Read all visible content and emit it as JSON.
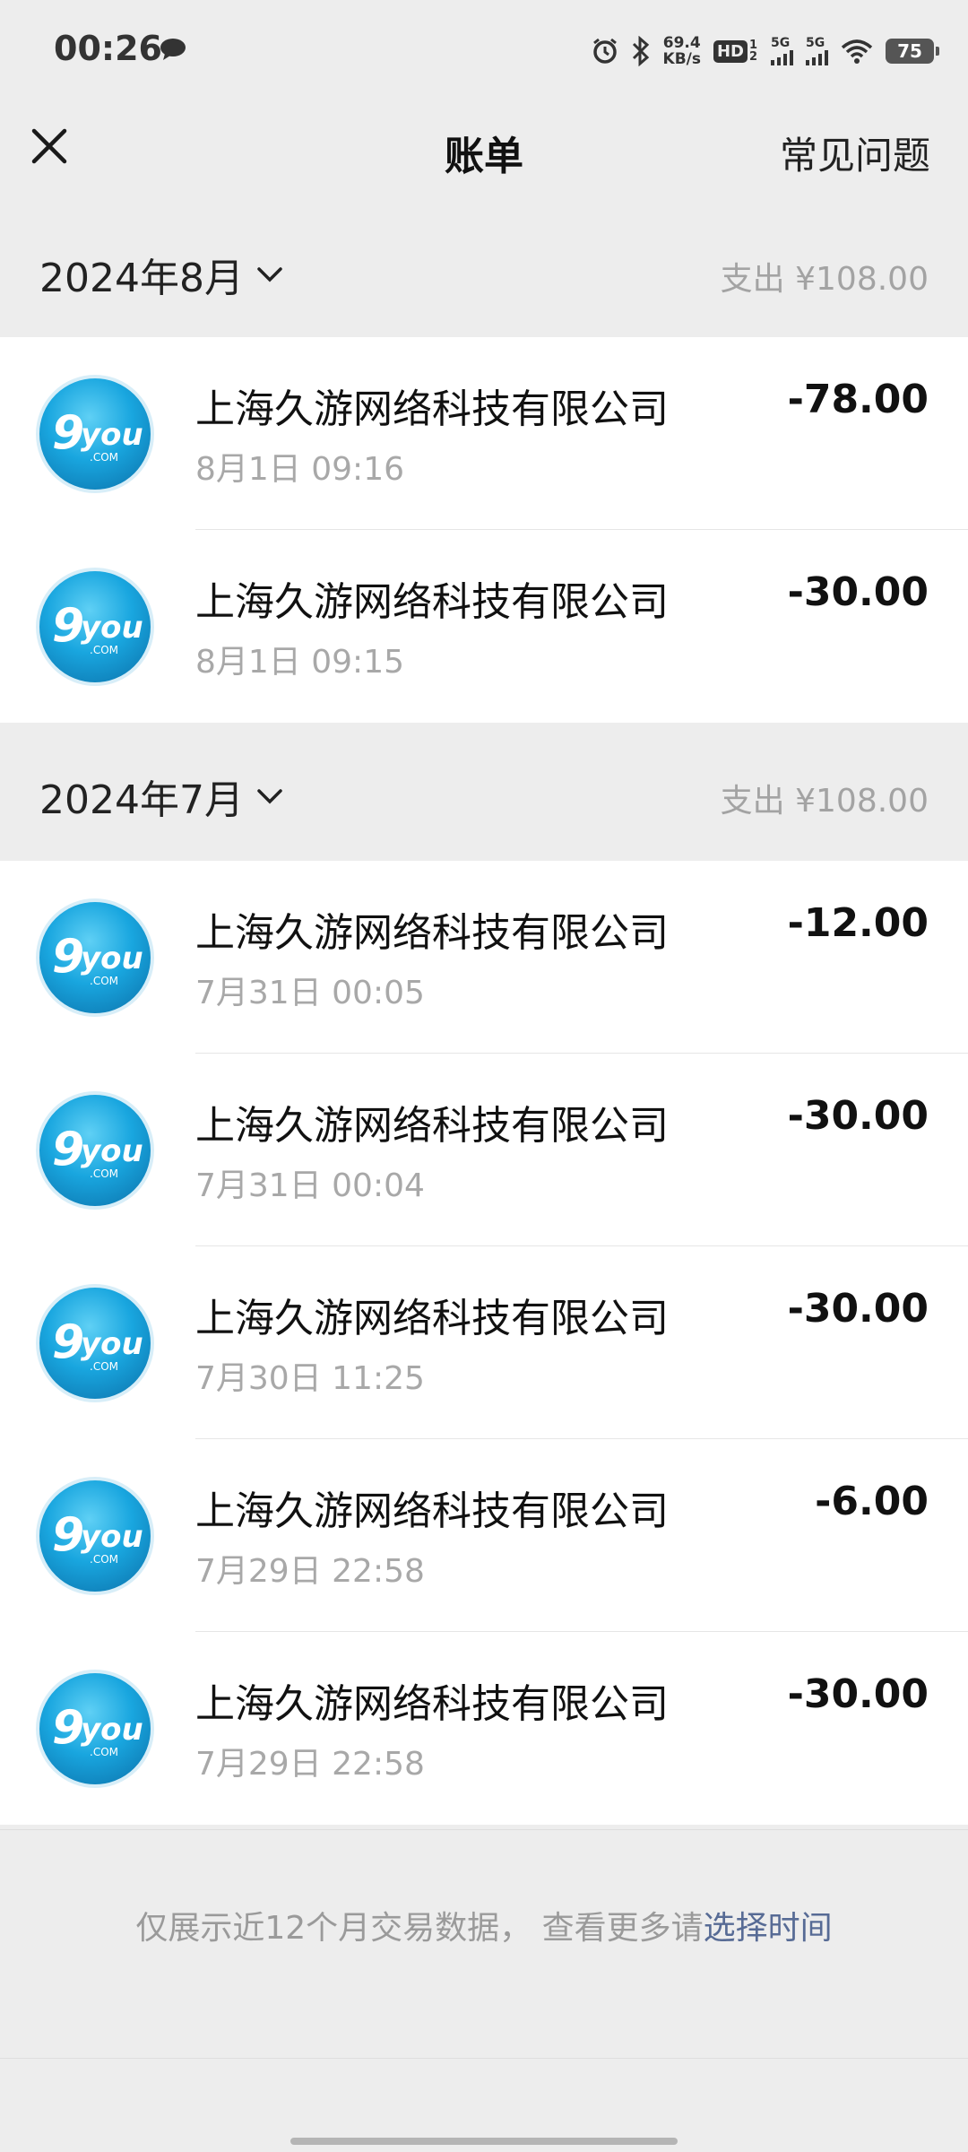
{
  "status_bar": {
    "time": "00:26",
    "net_speed_value": "69.4",
    "net_speed_unit": "KB/s",
    "hd_label": "HD",
    "hd_sub": "1 2",
    "sim1_label": "5G",
    "sim2_label": "5G",
    "battery": "75"
  },
  "nav": {
    "title": "账单",
    "faq_label": "常见问题"
  },
  "sections": [
    {
      "month": "2024年8月",
      "spend": "支出 ¥108.00",
      "transactions": [
        {
          "merchant": "上海久游网络科技有限公司",
          "time": "8月1日 09:16",
          "amount": "-78.00"
        },
        {
          "merchant": "上海久游网络科技有限公司",
          "time": "8月1日 09:15",
          "amount": "-30.00"
        }
      ]
    },
    {
      "month": "2024年7月",
      "spend": "支出 ¥108.00",
      "transactions": [
        {
          "merchant": "上海久游网络科技有限公司",
          "time": "7月31日 00:05",
          "amount": "-12.00"
        },
        {
          "merchant": "上海久游网络科技有限公司",
          "time": "7月31日 00:04",
          "amount": "-30.00"
        },
        {
          "merchant": "上海久游网络科技有限公司",
          "time": "7月30日 11:25",
          "amount": "-30.00"
        },
        {
          "merchant": "上海久游网络科技有限公司",
          "time": "7月29日 22:58",
          "amount": "-6.00"
        },
        {
          "merchant": "上海久游网络科技有限公司",
          "time": "7月29日 22:58",
          "amount": "-30.00"
        }
      ]
    }
  ],
  "footer": {
    "note": "仅展示近12个月交易数据， 查看更多请",
    "link": "选择时间"
  },
  "icons": {
    "merchant_logo": "9you-logo-icon",
    "close": "close-icon",
    "chevron": "chevron-down-icon"
  },
  "colors": {
    "link": "#576b95",
    "background": "#ededed",
    "secondary_text": "#a8a8a8"
  }
}
